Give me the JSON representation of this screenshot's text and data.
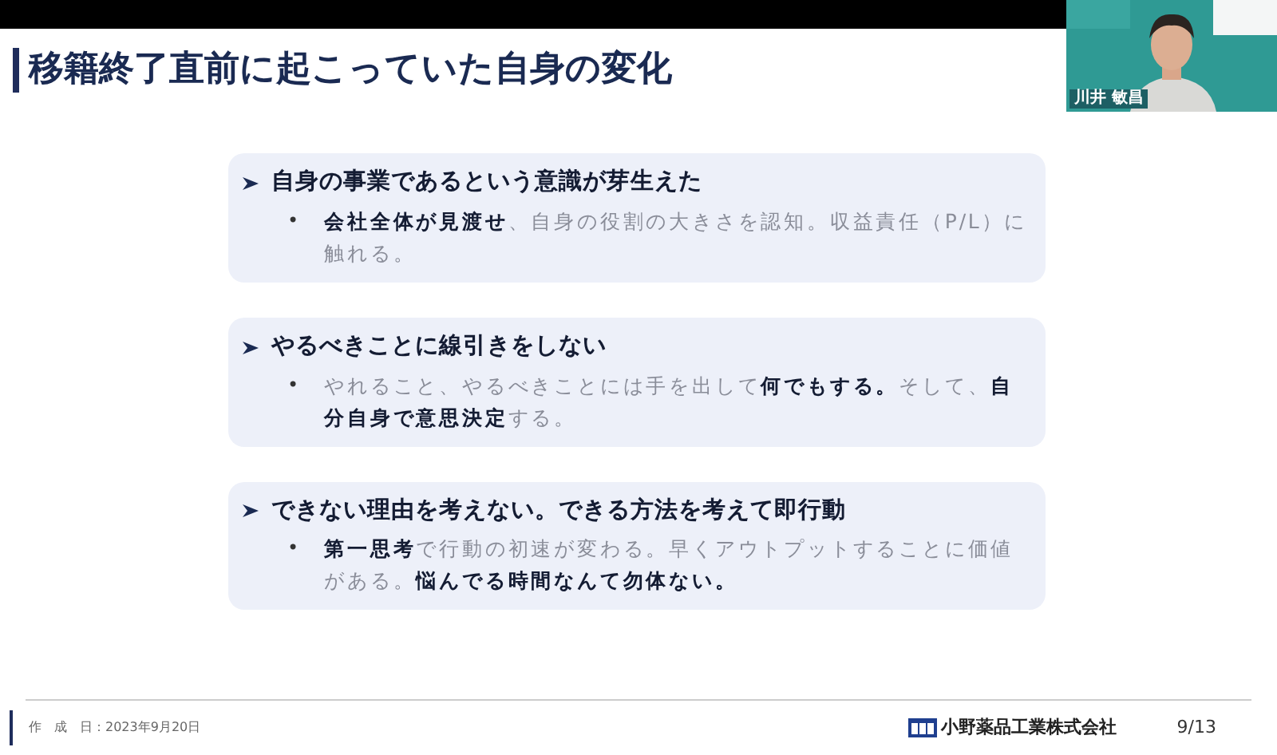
{
  "slide": {
    "title": "移籍終了直前に起こっていた自身の変化",
    "points": [
      {
        "heading": "自身の事業であるという意識が芽生えた",
        "bullet": "•",
        "detail": "**会社全体が見渡せ**、自身の役割の大きさを認知。収益責任（P/L）に触れる。"
      },
      {
        "heading": "やるべきことに線引きをしない",
        "bullet": "•",
        "detail": "やれること、やるべきことには手を出して**何でもする。**そして、**自分自身で意思決定**する。"
      },
      {
        "heading": "できない理由を考えない。できる方法を考えて即行動",
        "bullet": "•",
        "detail": "**第一思考**で行動の初速が変わる。早くアウトプットすることに価値がある。**悩んでる時間なんて勿体ない。**"
      }
    ],
    "footer": {
      "date": "作　成　日：2023年9月20日",
      "company": "小野薬品工業株式会社",
      "page": "9/13"
    }
  },
  "video": {
    "name": "川井 敏昌"
  }
}
